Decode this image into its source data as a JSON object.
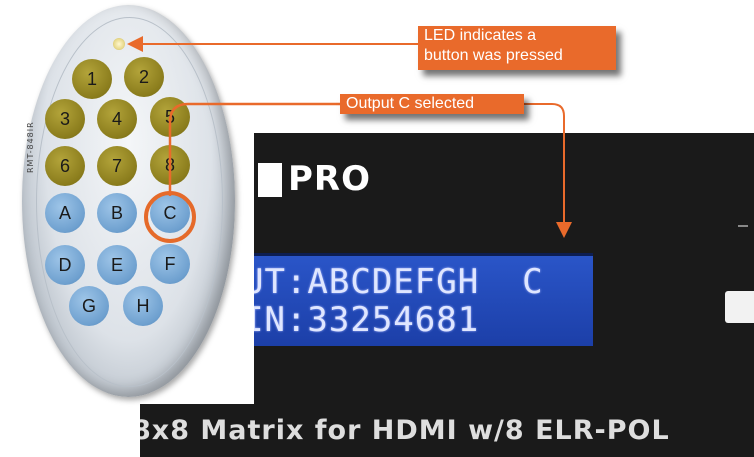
{
  "callouts": {
    "led_line1": "LED indicates a",
    "led_line2": "button was pressed",
    "output_selected": "Output C selected"
  },
  "remote": {
    "model": "RMT-848IR",
    "number_buttons": [
      "1",
      "2",
      "3",
      "4",
      "5",
      "6",
      "7",
      "8"
    ],
    "letter_buttons": [
      "A",
      "B",
      "C",
      "D",
      "E",
      "F",
      "G",
      "H"
    ],
    "highlighted_button": "C"
  },
  "device": {
    "logo_text": "PRO",
    "lcd_line1": "UT:ABCDEFGH  C",
    "lcd_line2": "IN:33254681",
    "bottom_label": "8x8 Matrix for HDMI w/8 ELR-POL"
  },
  "colors": {
    "callout": "#e96a2b",
    "lcd": "#2a55c8",
    "olive_button": "#8a7c1c",
    "blue_button": "#6ea0cf"
  }
}
